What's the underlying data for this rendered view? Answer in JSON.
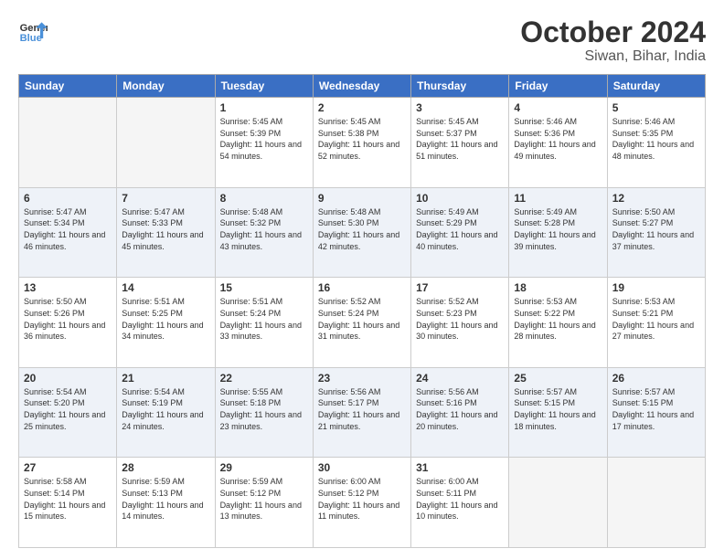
{
  "header": {
    "logo_line1": "General",
    "logo_line2": "Blue",
    "title": "October 2024",
    "subtitle": "Siwan, Bihar, India"
  },
  "days_of_week": [
    "Sunday",
    "Monday",
    "Tuesday",
    "Wednesday",
    "Thursday",
    "Friday",
    "Saturday"
  ],
  "weeks": [
    [
      {
        "day": "",
        "info": ""
      },
      {
        "day": "",
        "info": ""
      },
      {
        "day": "1",
        "info": "Sunrise: 5:45 AM\nSunset: 5:39 PM\nDaylight: 11 hours and 54 minutes."
      },
      {
        "day": "2",
        "info": "Sunrise: 5:45 AM\nSunset: 5:38 PM\nDaylight: 11 hours and 52 minutes."
      },
      {
        "day": "3",
        "info": "Sunrise: 5:45 AM\nSunset: 5:37 PM\nDaylight: 11 hours and 51 minutes."
      },
      {
        "day": "4",
        "info": "Sunrise: 5:46 AM\nSunset: 5:36 PM\nDaylight: 11 hours and 49 minutes."
      },
      {
        "day": "5",
        "info": "Sunrise: 5:46 AM\nSunset: 5:35 PM\nDaylight: 11 hours and 48 minutes."
      }
    ],
    [
      {
        "day": "6",
        "info": "Sunrise: 5:47 AM\nSunset: 5:34 PM\nDaylight: 11 hours and 46 minutes."
      },
      {
        "day": "7",
        "info": "Sunrise: 5:47 AM\nSunset: 5:33 PM\nDaylight: 11 hours and 45 minutes."
      },
      {
        "day": "8",
        "info": "Sunrise: 5:48 AM\nSunset: 5:32 PM\nDaylight: 11 hours and 43 minutes."
      },
      {
        "day": "9",
        "info": "Sunrise: 5:48 AM\nSunset: 5:30 PM\nDaylight: 11 hours and 42 minutes."
      },
      {
        "day": "10",
        "info": "Sunrise: 5:49 AM\nSunset: 5:29 PM\nDaylight: 11 hours and 40 minutes."
      },
      {
        "day": "11",
        "info": "Sunrise: 5:49 AM\nSunset: 5:28 PM\nDaylight: 11 hours and 39 minutes."
      },
      {
        "day": "12",
        "info": "Sunrise: 5:50 AM\nSunset: 5:27 PM\nDaylight: 11 hours and 37 minutes."
      }
    ],
    [
      {
        "day": "13",
        "info": "Sunrise: 5:50 AM\nSunset: 5:26 PM\nDaylight: 11 hours and 36 minutes."
      },
      {
        "day": "14",
        "info": "Sunrise: 5:51 AM\nSunset: 5:25 PM\nDaylight: 11 hours and 34 minutes."
      },
      {
        "day": "15",
        "info": "Sunrise: 5:51 AM\nSunset: 5:24 PM\nDaylight: 11 hours and 33 minutes."
      },
      {
        "day": "16",
        "info": "Sunrise: 5:52 AM\nSunset: 5:24 PM\nDaylight: 11 hours and 31 minutes."
      },
      {
        "day": "17",
        "info": "Sunrise: 5:52 AM\nSunset: 5:23 PM\nDaylight: 11 hours and 30 minutes."
      },
      {
        "day": "18",
        "info": "Sunrise: 5:53 AM\nSunset: 5:22 PM\nDaylight: 11 hours and 28 minutes."
      },
      {
        "day": "19",
        "info": "Sunrise: 5:53 AM\nSunset: 5:21 PM\nDaylight: 11 hours and 27 minutes."
      }
    ],
    [
      {
        "day": "20",
        "info": "Sunrise: 5:54 AM\nSunset: 5:20 PM\nDaylight: 11 hours and 25 minutes."
      },
      {
        "day": "21",
        "info": "Sunrise: 5:54 AM\nSunset: 5:19 PM\nDaylight: 11 hours and 24 minutes."
      },
      {
        "day": "22",
        "info": "Sunrise: 5:55 AM\nSunset: 5:18 PM\nDaylight: 11 hours and 23 minutes."
      },
      {
        "day": "23",
        "info": "Sunrise: 5:56 AM\nSunset: 5:17 PM\nDaylight: 11 hours and 21 minutes."
      },
      {
        "day": "24",
        "info": "Sunrise: 5:56 AM\nSunset: 5:16 PM\nDaylight: 11 hours and 20 minutes."
      },
      {
        "day": "25",
        "info": "Sunrise: 5:57 AM\nSunset: 5:15 PM\nDaylight: 11 hours and 18 minutes."
      },
      {
        "day": "26",
        "info": "Sunrise: 5:57 AM\nSunset: 5:15 PM\nDaylight: 11 hours and 17 minutes."
      }
    ],
    [
      {
        "day": "27",
        "info": "Sunrise: 5:58 AM\nSunset: 5:14 PM\nDaylight: 11 hours and 15 minutes."
      },
      {
        "day": "28",
        "info": "Sunrise: 5:59 AM\nSunset: 5:13 PM\nDaylight: 11 hours and 14 minutes."
      },
      {
        "day": "29",
        "info": "Sunrise: 5:59 AM\nSunset: 5:12 PM\nDaylight: 11 hours and 13 minutes."
      },
      {
        "day": "30",
        "info": "Sunrise: 6:00 AM\nSunset: 5:12 PM\nDaylight: 11 hours and 11 minutes."
      },
      {
        "day": "31",
        "info": "Sunrise: 6:00 AM\nSunset: 5:11 PM\nDaylight: 11 hours and 10 minutes."
      },
      {
        "day": "",
        "info": ""
      },
      {
        "day": "",
        "info": ""
      }
    ]
  ]
}
